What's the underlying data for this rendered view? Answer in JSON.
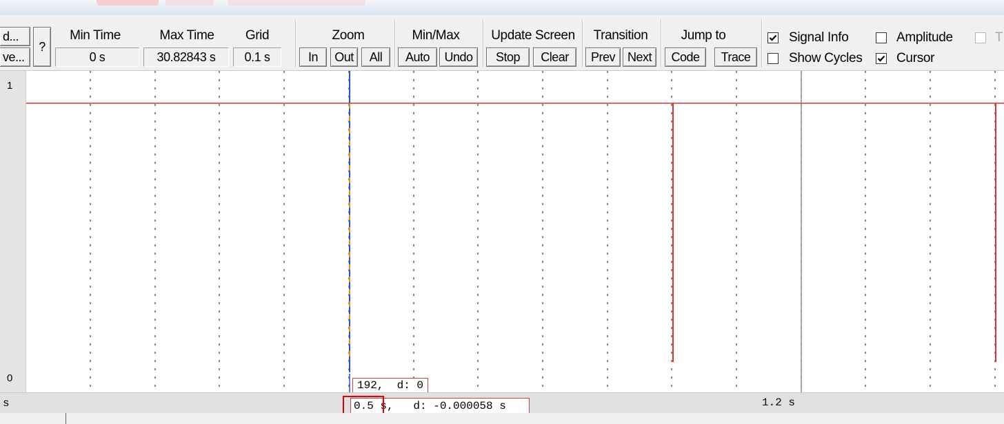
{
  "toolbar": {
    "partial_top": "d...",
    "partial_bottom": "ve...",
    "help": "?",
    "min_time": {
      "label": "Min Time",
      "value": "0 s"
    },
    "max_time": {
      "label": "Max Time",
      "value": "30.82843 s"
    },
    "grid": {
      "label": "Grid",
      "value": "0.1 s"
    },
    "zoom": {
      "label": "Zoom",
      "in": "In",
      "out": "Out",
      "all": "All"
    },
    "minmax": {
      "label": "Min/Max",
      "auto": "Auto",
      "undo": "Undo"
    },
    "update": {
      "label": "Update Screen",
      "stop": "Stop",
      "clear": "Clear"
    },
    "transition": {
      "label": "Transition",
      "prev": "Prev",
      "next": "Next"
    },
    "jump": {
      "label": "Jump to",
      "code": "Code",
      "trace": "Trace"
    },
    "options": {
      "signal_info": {
        "label": "Signal Info",
        "checked": true
      },
      "show_cycles": {
        "label": "Show Cycles",
        "checked": false
      },
      "amplitude": {
        "label": "Amplitude",
        "checked": false
      },
      "cursor": {
        "label": "Cursor",
        "checked": true
      },
      "partial_right": "T"
    }
  },
  "plot": {
    "y_top": "1",
    "y_bottom": "0",
    "value_readout": "192,  d: 0",
    "time_readout": "0.5 s,   d: -0.000058 s",
    "axis_left_partial": "s",
    "axis_right_label": "1.2 s"
  },
  "colors": {
    "signal": "#e03030",
    "cursor": "#2a50d0",
    "highlight": "#e00000"
  }
}
